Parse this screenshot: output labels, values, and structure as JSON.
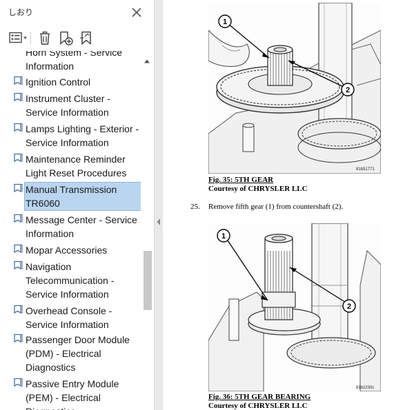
{
  "panel": {
    "title": "しおり",
    "toolbar": {
      "options_icon": "list-options-icon",
      "delete_icon": "trash-icon",
      "new_bookmark_icon": "add-bookmark-icon",
      "find_bookmark_icon": "find-bookmark-icon",
      "close_icon": "close-icon"
    },
    "items": [
      {
        "label": "Horn System - Service Information",
        "selected": false
      },
      {
        "label": "Ignition Control",
        "selected": false
      },
      {
        "label": "Instrument Cluster - Service Information",
        "selected": false
      },
      {
        "label": "Lamps Lighting - Exterior - Service Information",
        "selected": false
      },
      {
        "label": "Maintenance Reminder Light Reset Procedures",
        "selected": false
      },
      {
        "label": "Manual Transmission TR6060",
        "selected": true
      },
      {
        "label": "Message Center - Service Information",
        "selected": false
      },
      {
        "label": "Mopar Accessories",
        "selected": false
      },
      {
        "label": "Navigation Telecommunication - Service Information",
        "selected": false
      },
      {
        "label": "Overhead Console - Service Information",
        "selected": false
      },
      {
        "label": "Passenger Door Module (PDM) - Electrical Diagnostics",
        "selected": false
      },
      {
        "label": "Passive Entry Module (PEM) - Electrical Diagnostics",
        "selected": false
      }
    ],
    "item_lines": [
      [
        "Horn System - Service",
        "Information"
      ],
      [
        "Ignition Control"
      ],
      [
        "Instrument Cluster -",
        "Service Information"
      ],
      [
        "Lamps Lighting - Exterior -",
        "Service Information"
      ],
      [
        "Maintenance Reminder",
        "Light Reset Procedures"
      ],
      [
        "Manual Transmission",
        "TR6060"
      ],
      [
        "Message Center - Service",
        "Information"
      ],
      [
        "Mopar Accessories"
      ],
      [
        "Navigation",
        "Telecommunication -",
        "Service Information"
      ],
      [
        "Overhead Console -",
        "Service Information"
      ],
      [
        "Passenger Door Module",
        "(PDM) - Electrical",
        "Diagnostics"
      ],
      [
        "Passive Entry Module",
        "(PEM) - Electrical",
        "Diagnostics"
      ]
    ]
  },
  "document": {
    "figure35": {
      "title": "Fig. 35: 5TH GEAR",
      "courtesy": "Courtesy of CHRYSLER LLC",
      "code": "81b51771",
      "callouts": [
        "1",
        "2"
      ]
    },
    "step": {
      "number": "25.",
      "text": "Remove fifth gear (1) from countershaft (2)."
    },
    "figure36": {
      "title": "Fig. 36: 5TH GEAR BEARING",
      "courtesy": "Courtesy of CHRYSLER LLC",
      "code": "81b2230c",
      "callouts": [
        "1",
        "2"
      ]
    }
  },
  "colors": {
    "selection_bg": "#b9d5f0",
    "selection_border": "#8db6de",
    "bookmark_icon": "#4a6f9a"
  }
}
